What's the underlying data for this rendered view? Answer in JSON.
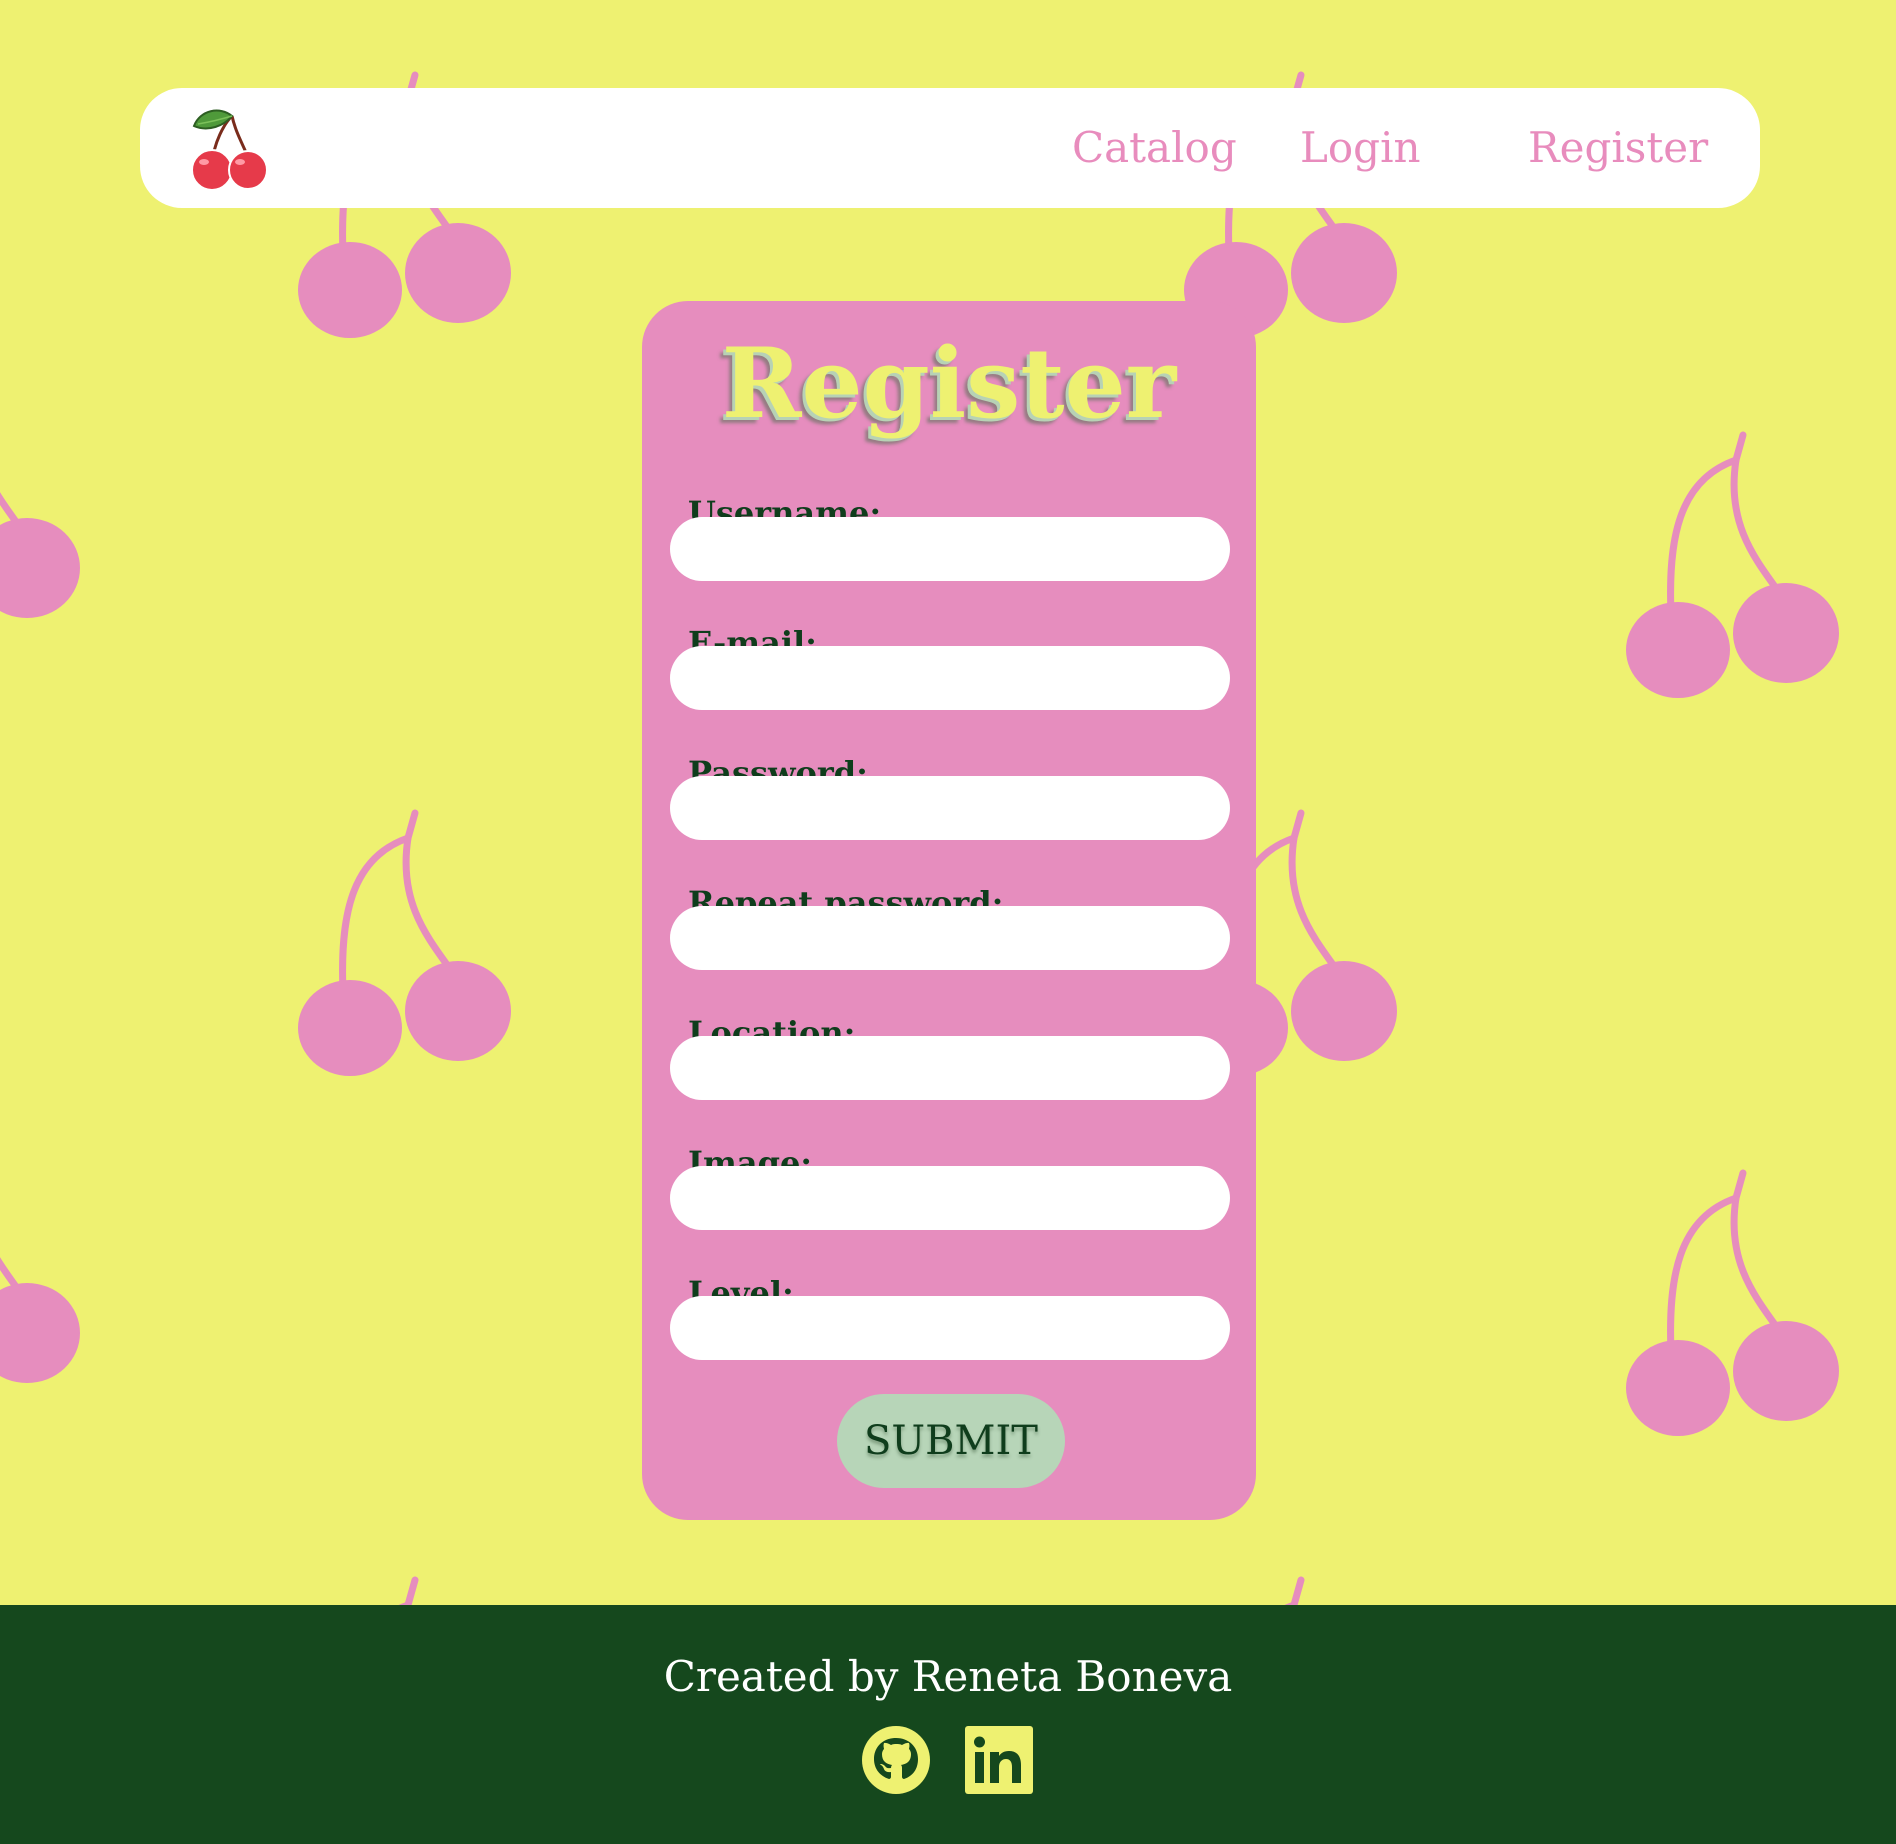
{
  "colors": {
    "background": "#eef171",
    "accent_pink": "#e68dbe",
    "footer_green": "#15481d",
    "button_green": "#b7d5b8"
  },
  "navbar": {
    "logo_icon": "cherry-icon",
    "links": [
      {
        "label": "Catalog"
      },
      {
        "label": "Login"
      },
      {
        "label": "Register"
      }
    ]
  },
  "form": {
    "title": "Register",
    "fields": [
      {
        "label": "Username:",
        "value": "",
        "placeholder": ""
      },
      {
        "label": "E-mail:",
        "value": "",
        "placeholder": ""
      },
      {
        "label": "Password:",
        "value": "",
        "placeholder": ""
      },
      {
        "label": "Repeat password:",
        "value": "",
        "placeholder": ""
      },
      {
        "label": "Location:",
        "value": "",
        "placeholder": ""
      },
      {
        "label": "Image:",
        "value": "",
        "placeholder": ""
      },
      {
        "label": "Level:",
        "value": "",
        "placeholder": ""
      }
    ],
    "submit_label": "SUBMIT"
  },
  "footer": {
    "credit": "Created by Reneta Boneva",
    "social_icons": [
      "github-icon",
      "linkedin-icon"
    ]
  }
}
